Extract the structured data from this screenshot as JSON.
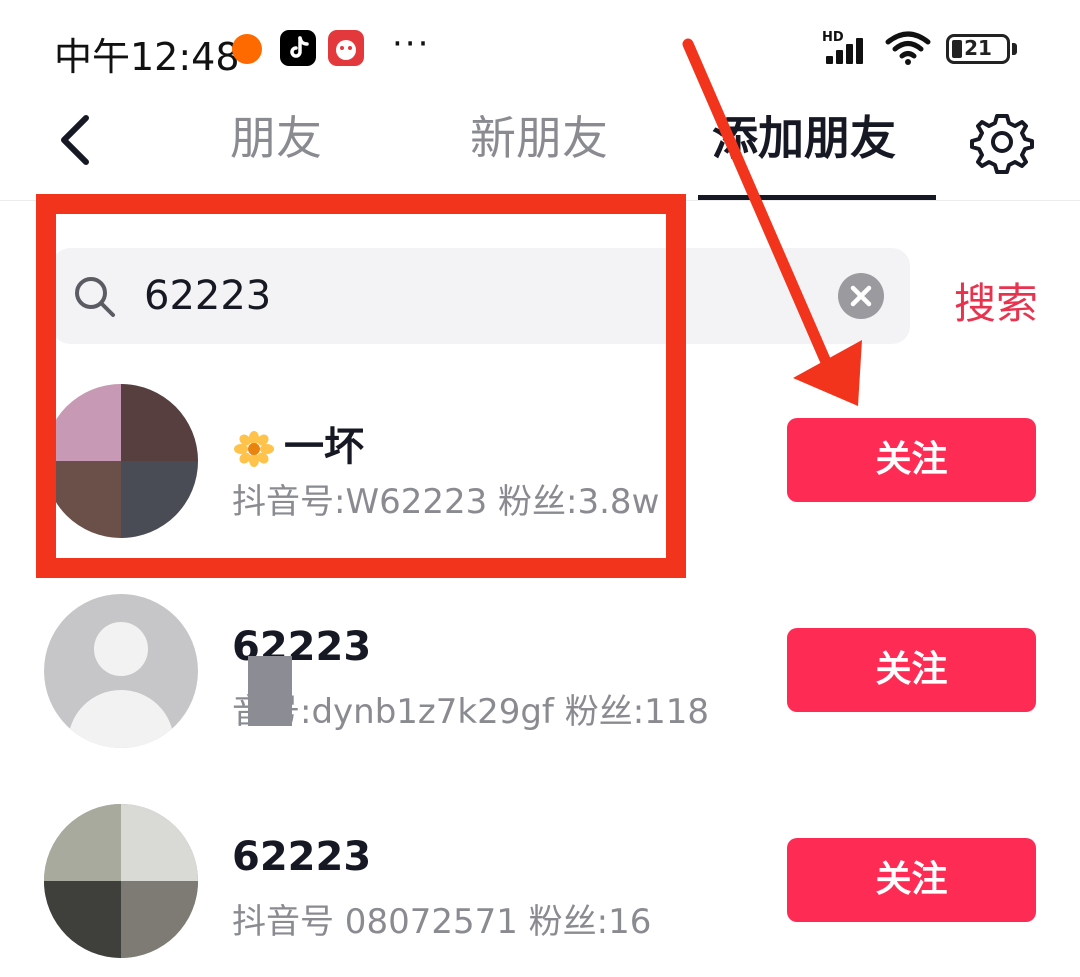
{
  "status_bar": {
    "time": "中午12:48",
    "dots": "···",
    "network": "HD",
    "battery": "21"
  },
  "header": {
    "back_icon": "chevron-left-icon",
    "tabs": [
      {
        "label": "朋友",
        "active": false
      },
      {
        "label": "新朋友",
        "active": false
      },
      {
        "label": "添加朋友",
        "active": true
      }
    ],
    "settings_icon": "gear-icon"
  },
  "search": {
    "value": "62223",
    "action_label": "搜索",
    "search_icon": "search-icon",
    "clear_icon": "clear-icon"
  },
  "results": [
    {
      "name": "一坏",
      "name_prefix_icon": "flower-icon",
      "meta": "抖音号:W62223 粉丝:3.8w",
      "follow_label": "关注"
    },
    {
      "name": "62223",
      "meta": "音号:dynb1z7k29gf 粉丝:118",
      "follow_label": "关注"
    },
    {
      "name": "62223",
      "meta": "抖音号 08072571 粉丝:16",
      "follow_label": "关注"
    }
  ],
  "colors": {
    "accent": "#fe2c55",
    "search_action": "#e8334f",
    "annotation": "#f1341b"
  }
}
